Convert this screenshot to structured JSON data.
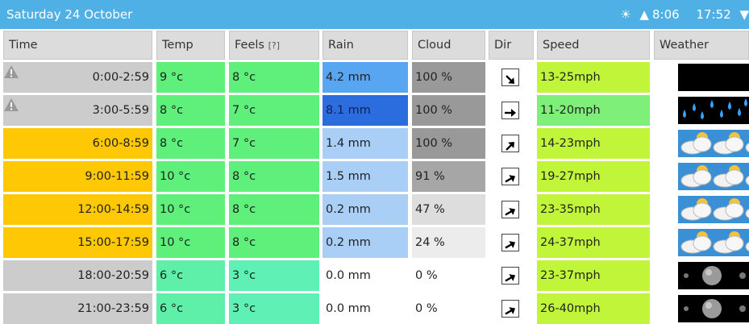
{
  "header": {
    "title": "Saturday 24 October",
    "sunrise": "8:06",
    "sunset": "17:52",
    "sun_glyph": "☀",
    "up_glyph": "▲",
    "down_glyph": "▼"
  },
  "columns": {
    "time": "Time",
    "temp": "Temp",
    "feels": "Feels",
    "feels_note": "[?]",
    "rain": "Rain",
    "cloud": "Cloud",
    "dir": "Dir",
    "speed": "Speed",
    "weather": "Weather"
  },
  "rows": [
    {
      "time": "0:00-2:59",
      "temp": "9 °c",
      "feels": "8 °c",
      "rain": "4.2 mm",
      "cloud": "100 %",
      "speed": "13-25mph",
      "warning": true,
      "colors": {
        "time": "#cccccc",
        "temp": "#5ef07a",
        "feels": "#5ef07a",
        "rain": "#58a6f2",
        "cloud": "#999999",
        "speed": "#c1f53a"
      },
      "dir_deg": 135,
      "weather_icon": "night-clear-icon"
    },
    {
      "time": "3:00-5:59",
      "temp": "8 °c",
      "feels": "7 °c",
      "rain": "8.1 mm",
      "cloud": "100 %",
      "speed": "11-20mph",
      "warning": true,
      "colors": {
        "time": "#cccccc",
        "temp": "#5ef07a",
        "feels": "#5ef07a",
        "rain": "#2b6cdf",
        "cloud": "#999999",
        "speed": "#7ef07a"
      },
      "dir_deg": 90,
      "weather_icon": "heavy-rain-icon"
    },
    {
      "time": "6:00-8:59",
      "temp": "8 °c",
      "feels": "7 °c",
      "rain": "1.4 mm",
      "cloud": "100 %",
      "speed": "14-23mph",
      "warning": false,
      "colors": {
        "time": "#ffc805",
        "temp": "#5ef07a",
        "feels": "#5ef07a",
        "rain": "#a9cff7",
        "cloud": "#999999",
        "speed": "#c1f53a"
      },
      "dir_deg": 45,
      "weather_icon": "partly-cloudy-icon"
    },
    {
      "time": "9:00-11:59",
      "temp": "10 °c",
      "feels": "8 °c",
      "rain": "1.5 mm",
      "cloud": "91 %",
      "speed": "19-27mph",
      "warning": false,
      "colors": {
        "time": "#ffc805",
        "temp": "#5ef07a",
        "feels": "#5ef07a",
        "rain": "#a9cff7",
        "cloud": "#a6a6a6",
        "speed": "#c1f53a"
      },
      "dir_deg": 60,
      "weather_icon": "partly-cloudy-icon"
    },
    {
      "time": "12:00-14:59",
      "temp": "10 °c",
      "feels": "8 °c",
      "rain": "0.2 mm",
      "cloud": "47 %",
      "speed": "23-35mph",
      "warning": false,
      "colors": {
        "time": "#ffc805",
        "temp": "#5ef07a",
        "feels": "#5ef07a",
        "rain": "#a9cff7",
        "cloud": "#dddddd",
        "speed": "#c1f53a"
      },
      "dir_deg": 60,
      "weather_icon": "partly-cloudy-icon"
    },
    {
      "time": "15:00-17:59",
      "temp": "10 °c",
      "feels": "8 °c",
      "rain": "0.2 mm",
      "cloud": "24 %",
      "speed": "24-37mph",
      "warning": false,
      "colors": {
        "time": "#ffc805",
        "temp": "#5ef07a",
        "feels": "#5ef07a",
        "rain": "#a9cff7",
        "cloud": "#ececec",
        "speed": "#c1f53a"
      },
      "dir_deg": 60,
      "weather_icon": "partly-cloudy-icon"
    },
    {
      "time": "18:00-20:59",
      "temp": "6 °c",
      "feels": "3 °c",
      "rain": "0.0 mm",
      "cloud": "0 %",
      "speed": "23-37mph",
      "warning": false,
      "colors": {
        "time": "#cccccc",
        "temp": "#5ef0a8",
        "feels": "#5ef0b5",
        "rain": "#ffffff",
        "cloud": "#ffffff",
        "speed": "#c1f53a"
      },
      "dir_deg": 60,
      "weather_icon": "night-moon-icon"
    },
    {
      "time": "21:00-23:59",
      "temp": "6 °c",
      "feels": "3 °c",
      "rain": "0.0 mm",
      "cloud": "0 %",
      "speed": "26-40mph",
      "warning": false,
      "colors": {
        "time": "#cccccc",
        "temp": "#5ef0a8",
        "feels": "#5ef0b5",
        "rain": "#ffffff",
        "cloud": "#ffffff",
        "speed": "#c1f53a"
      },
      "dir_deg": 60,
      "weather_icon": "night-moon-icon"
    }
  ]
}
